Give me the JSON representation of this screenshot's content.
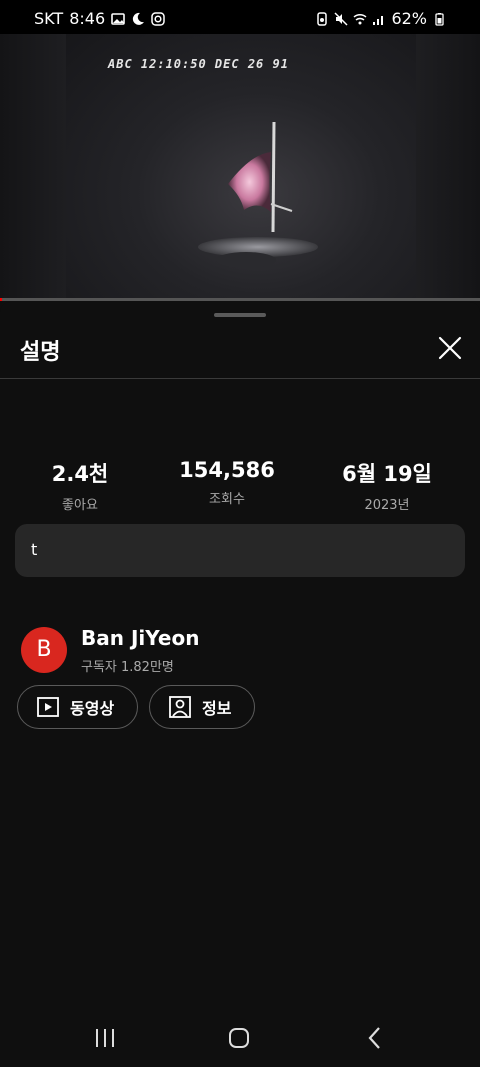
{
  "status_bar": {
    "carrier": "SKT",
    "time": "8:46",
    "battery": "62%"
  },
  "video": {
    "overlay_text": "ABC   12:10:50  DEC 26 91"
  },
  "sheet": {
    "title": "설명",
    "stats": [
      {
        "value": "2.4천",
        "label": "좋아요"
      },
      {
        "value": "154,586",
        "label": "조회수"
      },
      {
        "value": "6월 19일",
        "label": "2023년"
      }
    ],
    "description": "t"
  },
  "channel": {
    "avatar_letter": "B",
    "avatar_color": "#d9271f",
    "name": "Ban JiYeon",
    "subscribers": "구독자 1.82만명",
    "videos_button": "동영상",
    "about_button": "정보"
  },
  "colors": {
    "background": "#0f0f0f",
    "card": "#272727",
    "progress": "#ff0000"
  }
}
